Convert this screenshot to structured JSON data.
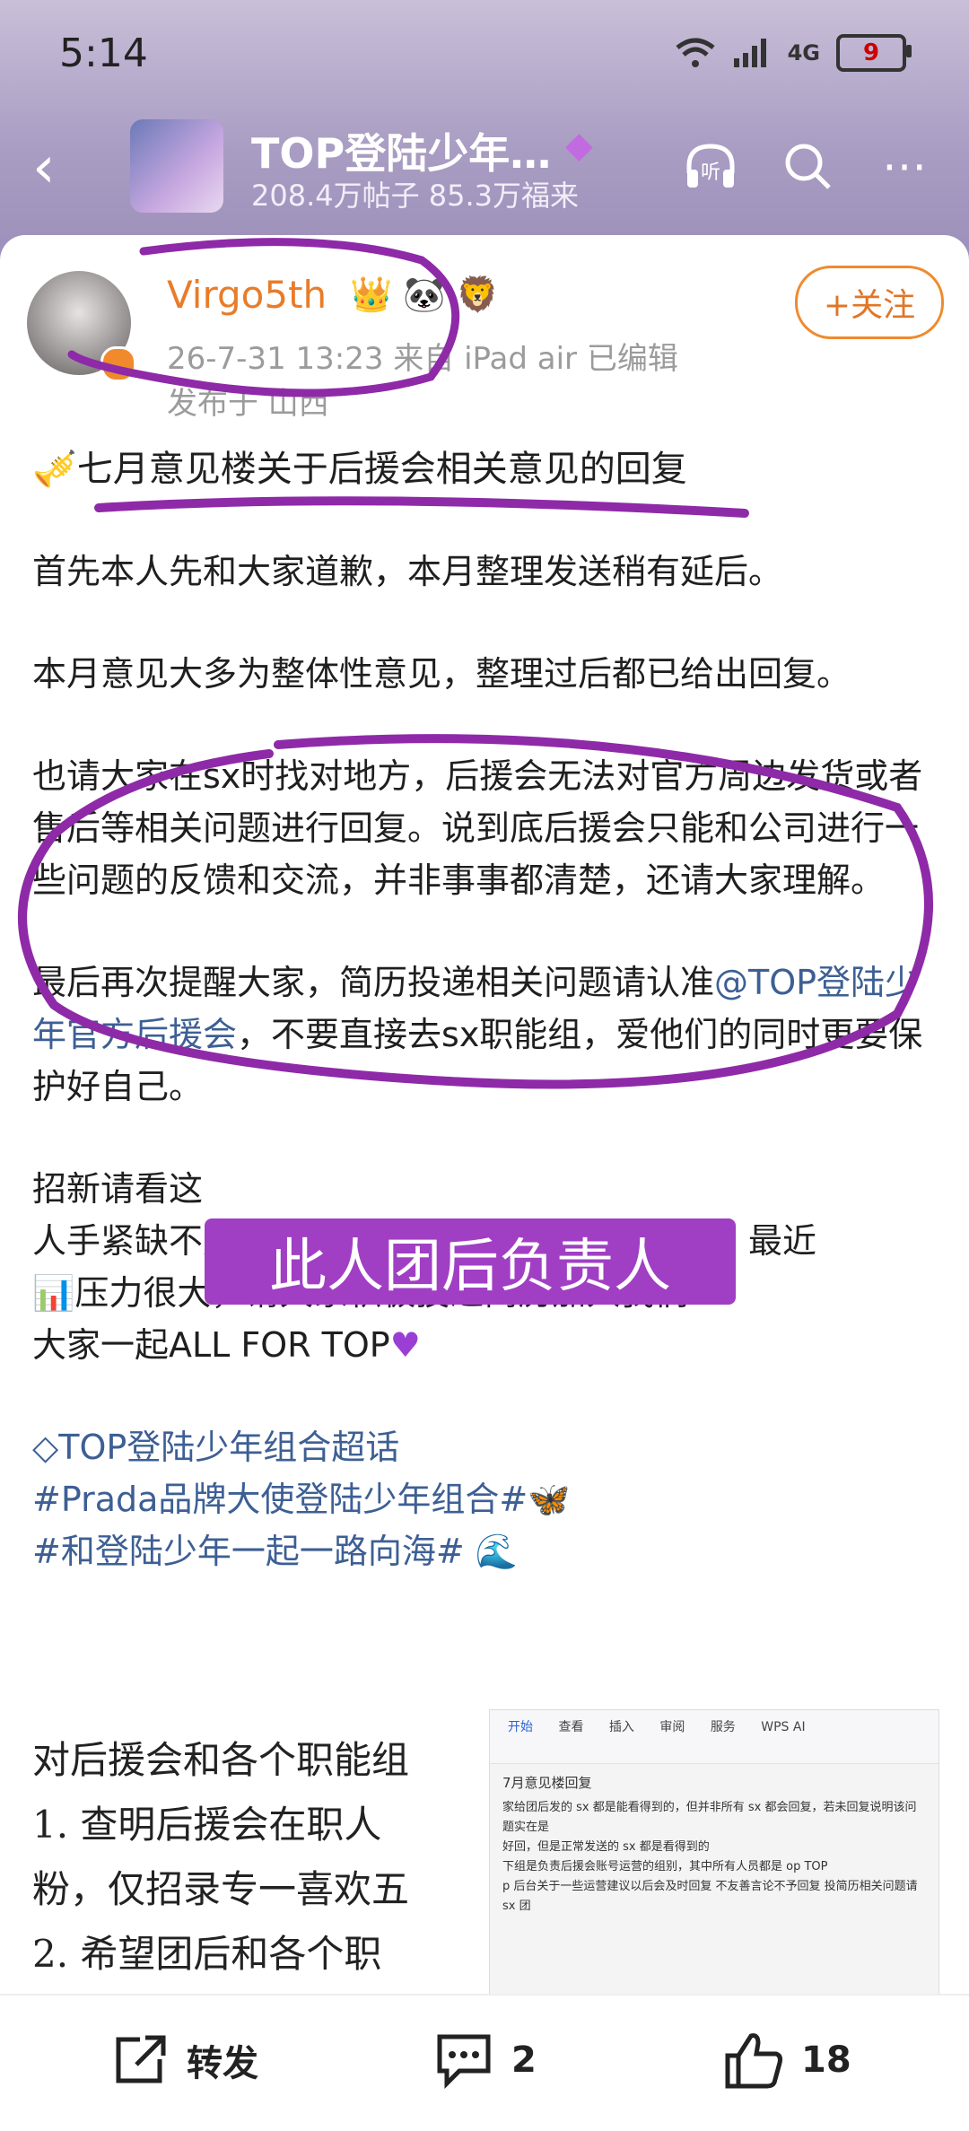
{
  "status_bar": {
    "time": "5:14",
    "network": "4G",
    "battery": "9"
  },
  "header": {
    "title": "TOP登陆少年…",
    "stats": "208.4万帖子 85.3万福来",
    "listen_label": "听"
  },
  "post": {
    "author": "Virgo5th",
    "meta": "26-7-31 13:23  来自 iPad air  已编辑",
    "location": "发布于 山西",
    "follow_label": "+关注",
    "headline": "七月意见楼关于后援会相关意见的回复",
    "para1": "首先本人先和大家道歉，本月整理发送稍有延后。",
    "para2": "本月意见大多为整体性意见，整理过后都已给出回复。",
    "para3": "也请大家在sx时找对地方，后援会无法对官方周边发货或者售后等相关问题进行回复。说到底后援会只能和公司进行一些问题的反馈和交流，并非事事都清楚，还请大家理解。",
    "para4_pre": "最后再次提醒大家，简历投递相关问题请认准",
    "para4_link": "@TOP登陆少年官方后援会",
    "para4_post": "，不要直接去sx职能组，爱他们的同时更要保护好自己。",
    "para5_l1": "招新请看这",
    "para5_l2": "人手紧缺不是在和大家开玩笑，团综即将上线，最近",
    "para5_l3": "压力很大，请大家积极投递简历加入我们",
    "para5_l4": "大家一起ALL FOR TOP",
    "tag1": "TOP登陆少年组合超话",
    "tag2": "#Prada品牌大使登陆少年组合#",
    "tag3": "#和登陆少年一起一路向海#",
    "doc_lines": [
      "对后援会和各个职能组",
      "1.    查明后援会在职人",
      "粉，仅招录专一喜欢五",
      "2.    希望团后和各个职"
    ],
    "doc_thumb_title": "7月意见楼回复",
    "doc_thumb_lines": [
      "家给团后发的 sx 都是能看得到的，但并非所有 sx 都会回复，若未回复说明该问题实在是",
      "好回，但是正常发送的 sx 都是看得到的",
      "下组是负责后援会账号运营的组别，其中所有人员都是 op TOP",
      "p 后台关于一些运营建议以后会及时回复  不友善言论不予回复  投简历相关问题请 sx 团"
    ],
    "doc_toolbar": [
      "开始",
      "查看",
      "插入",
      "审阅",
      "服务",
      "WPS AI"
    ]
  },
  "overlay_label": "此人团后负责人",
  "actions": {
    "repost": "转发",
    "comments": "2",
    "likes": "18"
  },
  "colors": {
    "accent_orange": "#e87c2a",
    "link_blue": "#3d5f94",
    "annotation_purple": "#8e2aa8"
  }
}
